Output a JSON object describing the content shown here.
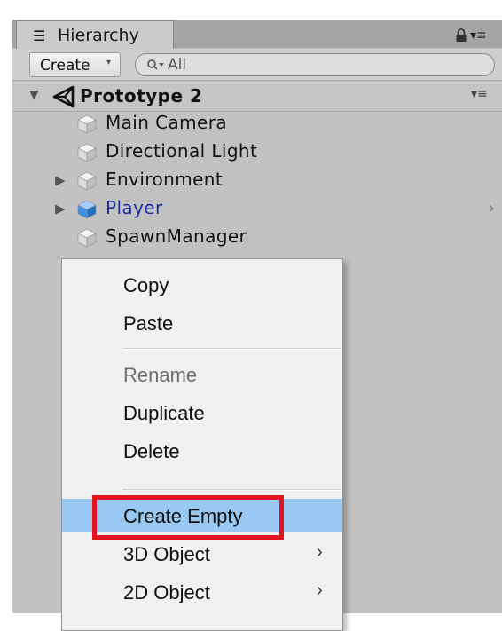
{
  "window": {
    "tab_label": "Hierarchy",
    "tab_icon": "list-icon",
    "lock_icon": "lock-icon",
    "menu_icon": "panel-menu-icon"
  },
  "toolbar": {
    "create_label": "Create",
    "create_arrow": "▾",
    "search_placeholder": "All"
  },
  "scene": {
    "name": "Prototype 2",
    "icon": "unity-icon",
    "expanded": true
  },
  "hierarchy": [
    {
      "label": "Main Camera",
      "icon": "gameobject-cube-icon",
      "foldout": false,
      "prefab": false
    },
    {
      "label": "Directional Light",
      "icon": "gameobject-cube-icon",
      "foldout": false,
      "prefab": false
    },
    {
      "label": "Environment",
      "icon": "gameobject-cube-icon",
      "foldout": true,
      "prefab": false
    },
    {
      "label": "Player",
      "icon": "prefab-cube-icon",
      "foldout": true,
      "prefab": true,
      "chevron": "›"
    },
    {
      "label": "SpawnManager",
      "icon": "gameobject-cube-icon",
      "foldout": false,
      "prefab": false
    }
  ],
  "context_menu": {
    "items": [
      {
        "label": "Copy",
        "enabled": true
      },
      {
        "label": "Paste",
        "enabled": true
      },
      {
        "label": "Rename",
        "enabled": false
      },
      {
        "label": "Duplicate",
        "enabled": true
      },
      {
        "label": "Delete",
        "enabled": true
      },
      {
        "label": "Create Empty",
        "enabled": true,
        "highlighted": true
      },
      {
        "label": "3D Object",
        "enabled": true,
        "submenu": "›"
      },
      {
        "label": "2D Object",
        "enabled": true,
        "submenu": "›"
      }
    ]
  },
  "colors": {
    "panel_bg": "#c2c2c2",
    "menu_bg": "#f0f0f0",
    "menu_highlight": "#99c9f2",
    "prefab_text": "#1d2e9e",
    "annotation_red": "#e0131f"
  }
}
